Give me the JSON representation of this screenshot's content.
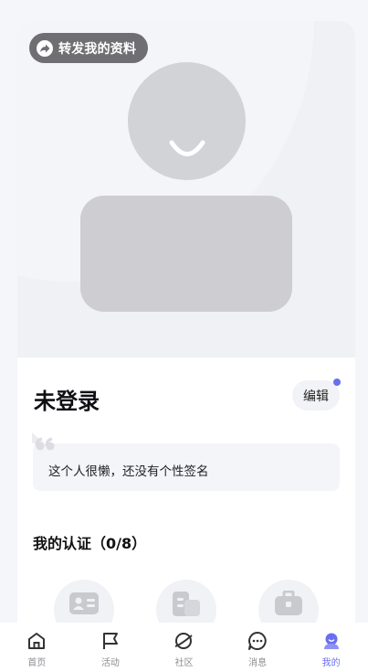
{
  "share_label": "转发我的资料",
  "user_name": "未登录",
  "edit_label": "编辑",
  "signature": "这个人很懒，还没有个性签名",
  "cert_title": "我的认证（0/8）",
  "certs": [
    {
      "icon": "id-card-icon"
    },
    {
      "icon": "building-icon"
    },
    {
      "icon": "briefcase-icon"
    }
  ],
  "tabs": [
    {
      "label": "首页",
      "icon": "home-icon"
    },
    {
      "label": "活动",
      "icon": "flag-icon"
    },
    {
      "label": "社区",
      "icon": "planet-icon"
    },
    {
      "label": "消息",
      "icon": "chat-icon"
    },
    {
      "label": "我的",
      "icon": "profile-icon",
      "active": true
    }
  ],
  "colors": {
    "accent": "#6b6ef0",
    "share_bg": "#6f6f73",
    "avatar": "#d2d3d7"
  }
}
